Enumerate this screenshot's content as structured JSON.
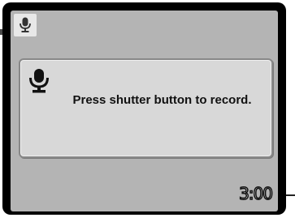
{
  "status_bar": {
    "mode_icon": "microphone-icon"
  },
  "dialog": {
    "icon": "microphone-icon",
    "message": "Press shutter button to record."
  },
  "recording": {
    "time_remaining": "3:00"
  },
  "colors": {
    "lcd_background": "#b4b4b4",
    "dialog_background": "#d8d8d8",
    "frame": "#000000"
  }
}
